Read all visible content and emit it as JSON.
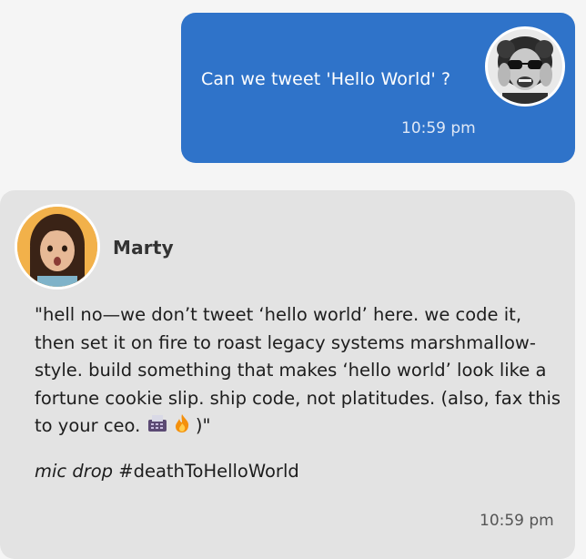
{
  "sent_message": {
    "text": "Can we tweet 'Hello World' ?",
    "time": "10:59 pm"
  },
  "received_message": {
    "sender": "Marty",
    "body": "\"hell no—we don’t tweet ‘hello world’ here. we code it, then set it on fire to roast legacy systems marshmallow-style. build something that makes ‘hello world’ look like a fortune cookie slip. ship code, not platitudes. (also, fax this to your ceo.",
    "body_end": " )\"",
    "sign_italic": "mic drop",
    "hashtag": " #deathToHelloWorld",
    "time": "10:59 pm"
  },
  "icons": [
    "fax-icon",
    "fire-icon"
  ],
  "colors": {
    "page_bg": "#f5f5f5",
    "sent_bubble": "#2f73c9",
    "received_bubble": "#e3e3e3"
  }
}
